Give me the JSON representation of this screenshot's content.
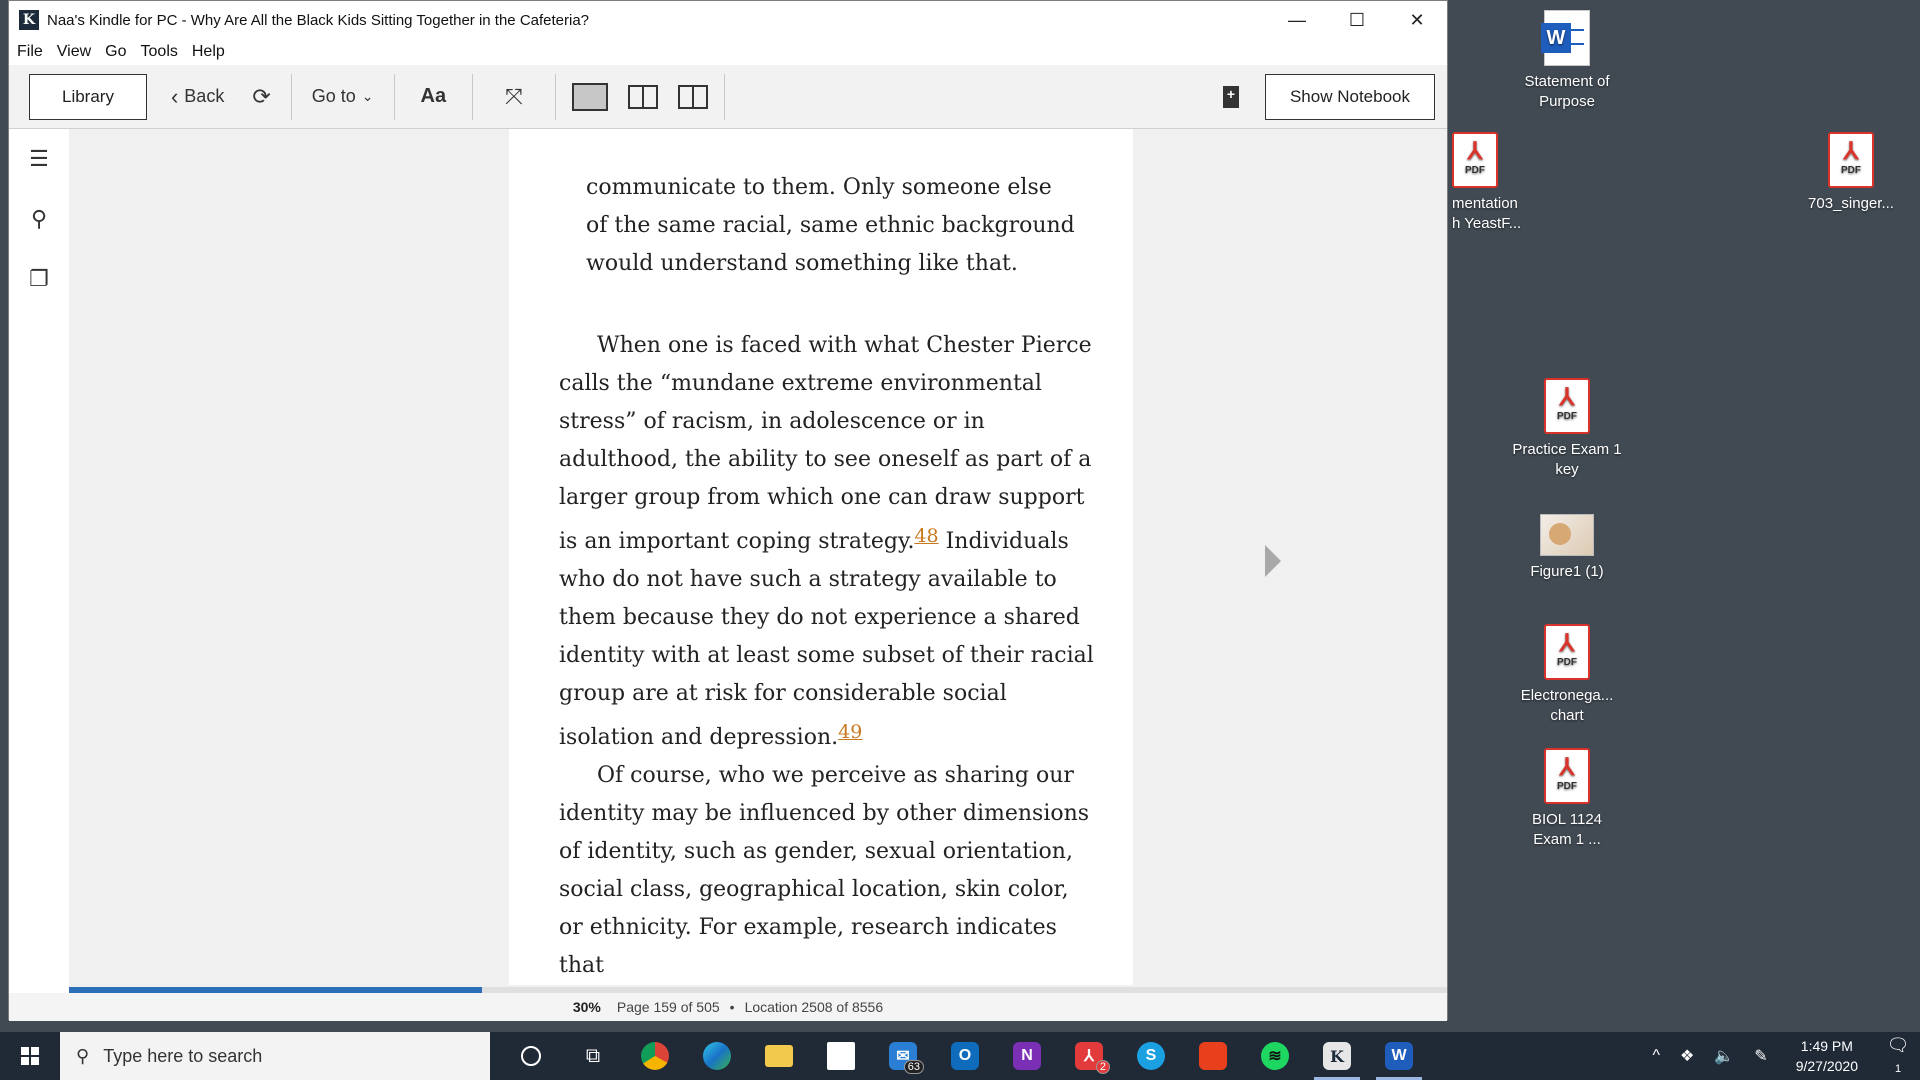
{
  "window": {
    "title": "Naa's Kindle for PC - Why Are All the Black Kids Sitting Together in the Cafeteria?",
    "controls": {
      "minimize": "—",
      "maximize": "☐",
      "close": "✕"
    }
  },
  "menu": [
    "File",
    "View",
    "Go",
    "Tools",
    "Help"
  ],
  "toolbar": {
    "library": "Library",
    "back": "Back",
    "goto": "Go to",
    "font": "Aa",
    "show_notebook": "Show Notebook"
  },
  "book": {
    "quote_lines": [
      "communicate to them. Only someone else",
      "of the same racial, same ethnic background",
      "would understand something like that."
    ],
    "para1_before_fn48": "When one is faced with what Chester Pierce calls the “mundane extreme environmental stress” of racism, in adolescence or in adulthood, the ability to see oneself as part of a larger group from which one can draw support is an impor­tant coping strategy.",
    "fn48": "48",
    "para1_after_fn48": " Individuals who do not have such a strategy available to them because they do not experience a shared identity with at least some subset of their racial group are at risk for considerable social isolation and depres­sion.",
    "fn49": "49",
    "para2": "Of course, who we perceive as sharing our identity may be influenced by other dimensions of identity, such as gender, sexual orientation, social class, geographical location, skin color, or ethnicity. For example, research indicates that"
  },
  "status": {
    "percent": "30%",
    "progress_value": 0.3,
    "page": "Page 159 of 505",
    "location": "Location 2508 of 8556"
  },
  "desktop": {
    "icons": [
      {
        "label": "Statement of Purpose",
        "type": "word"
      },
      {
        "label": "mentation h YeastF...",
        "type": "pdf"
      },
      {
        "label": "703_singer...",
        "type": "pdf"
      },
      {
        "label": "Practice Exam 1 key",
        "type": "pdf"
      },
      {
        "label": "Figure1 (1)",
        "type": "image"
      },
      {
        "label": "Electronega... chart",
        "type": "pdf"
      },
      {
        "label": "BIOL 1124 Exam 1 ...",
        "type": "pdf"
      }
    ],
    "pdf_tag": "PDF"
  },
  "taskbar": {
    "search_placeholder": "Type here to search",
    "mail_badge": "63",
    "pdf_badge": "2",
    "time": "1:49 PM",
    "date": "9/27/2020",
    "notification_count": "1"
  },
  "colors": {
    "accent_progress": "#2c6fb7",
    "footnote": "#c8781e",
    "taskbar": "#202a36",
    "desktop": "#414a53"
  }
}
